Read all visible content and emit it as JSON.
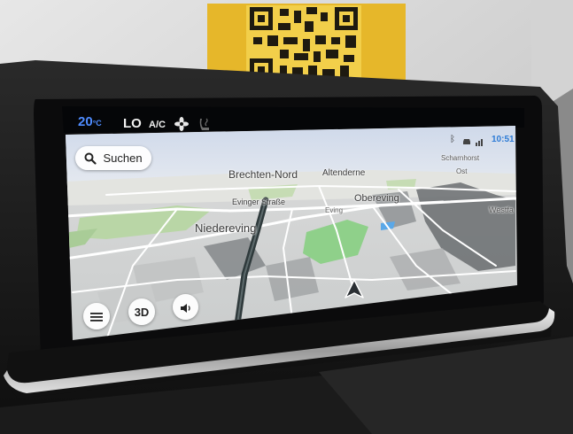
{
  "climate_bar": {
    "temperature": "20",
    "temperature_unit": "°C",
    "fan_level": "LO",
    "ac_label": "A/C",
    "fan_icon": "fan-icon",
    "seat_heat_icon": "seat-heat-icon",
    "accent_color": "#4f8cff"
  },
  "status_bar": {
    "time": "10:51",
    "icons": [
      "bluetooth-icon",
      "connected-car-icon",
      "signal-icon"
    ]
  },
  "search": {
    "label": "Suchen",
    "icon": "search-icon"
  },
  "map_controls": {
    "menu_icon": "menu-icon",
    "view_mode_label": "3D",
    "sound_icon": "speaker-icon"
  },
  "map": {
    "labels": [
      "Brechten-Nord",
      "Altenderne",
      "Scharnhorst",
      "Ost",
      "Evinger Straße",
      "Obereving",
      "Eving",
      "Niedereving",
      "Westfa"
    ],
    "position_marker": "navigation-arrow-icon"
  }
}
